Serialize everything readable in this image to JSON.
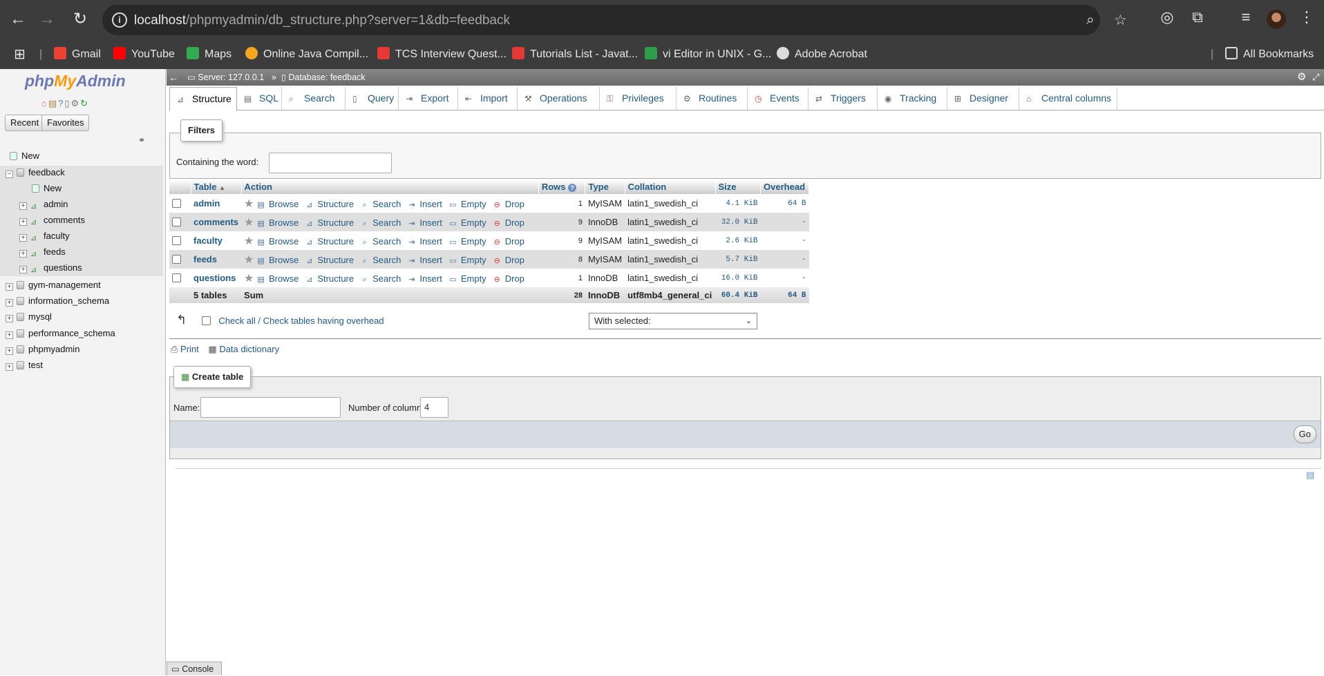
{
  "browser": {
    "url_host": "localhost",
    "url_path": "/phpmyadmin/db_structure.php?server=1&db=feedback",
    "bookmarks": [
      {
        "label": "Gmail",
        "color": "#ea4335"
      },
      {
        "label": "YouTube",
        "color": "#ff0000"
      },
      {
        "label": "Maps",
        "color": "#34a853"
      },
      {
        "label": "Online Java Compil...",
        "color": "#f5a623"
      },
      {
        "label": "TCS Interview Quest...",
        "color": "#e53935"
      },
      {
        "label": "Tutorials List - Javat...",
        "color": "#e53935"
      },
      {
        "label": "vi Editor in UNIX - G...",
        "color": "#2e9c4a"
      },
      {
        "label": "Adobe Acrobat",
        "color": "#dddddd"
      }
    ],
    "all_bookmarks": "All Bookmarks"
  },
  "sidebar": {
    "logo_php": "php",
    "logo_my": "My",
    "logo_admin": "Admin",
    "recent": "Recent",
    "favorites": "Favorites",
    "tree": {
      "new_root": "New",
      "feedback": "feedback",
      "new_table": "New",
      "tables": [
        "admin",
        "comments",
        "faculty",
        "feeds",
        "questions"
      ],
      "databases": [
        "gym-management",
        "information_schema",
        "mysql",
        "performance_schema",
        "phpmyadmin",
        "test"
      ]
    }
  },
  "breadcrumb": {
    "server": "Server: 127.0.0.1",
    "sep": "»",
    "database": "Database: feedback"
  },
  "tabs": [
    "Structure",
    "SQL",
    "Search",
    "Query",
    "Export",
    "Import",
    "Operations",
    "Privileges",
    "Routines",
    "Events",
    "Triggers",
    "Tracking",
    "Designer",
    "Central columns"
  ],
  "filters": {
    "legend": "Filters",
    "label": "Containing the word:",
    "value": ""
  },
  "table": {
    "headers": {
      "table": "Table",
      "action": "Action",
      "rows": "Rows",
      "type": "Type",
      "collation": "Collation",
      "size": "Size",
      "overhead": "Overhead"
    },
    "actions": [
      "Browse",
      "Structure",
      "Search",
      "Insert",
      "Empty",
      "Drop"
    ],
    "rows": [
      {
        "name": "admin",
        "rows": "1",
        "type": "MyISAM",
        "collation": "latin1_swedish_ci",
        "size": "4.1 KiB",
        "overhead": "64 B"
      },
      {
        "name": "comments",
        "rows": "9",
        "type": "InnoDB",
        "collation": "latin1_swedish_ci",
        "size": "32.0 KiB",
        "overhead": "-"
      },
      {
        "name": "faculty",
        "rows": "9",
        "type": "MyISAM",
        "collation": "latin1_swedish_ci",
        "size": "2.6 KiB",
        "overhead": "-"
      },
      {
        "name": "feeds",
        "rows": "8",
        "type": "MyISAM",
        "collation": "latin1_swedish_ci",
        "size": "5.7 KiB",
        "overhead": "-"
      },
      {
        "name": "questions",
        "rows": "1",
        "type": "InnoDB",
        "collation": "latin1_swedish_ci",
        "size": "16.0 KiB",
        "overhead": "-"
      }
    ],
    "footer": {
      "name": "5 tables",
      "sum": "Sum",
      "rows": "28",
      "type": "InnoDB",
      "collation": "utf8mb4_general_ci",
      "size": "60.4 KiB",
      "overhead": "64 B"
    }
  },
  "bulk": {
    "check_all": "Check all / Check tables having overhead",
    "with_selected": "With selected:"
  },
  "links": {
    "print": "Print",
    "data_dictionary": "Data dictionary"
  },
  "create_table": {
    "legend": "Create table",
    "name_label": "Name:",
    "name_value": "",
    "columns_label": "Number of columns:",
    "columns_value": "4",
    "go": "Go"
  },
  "console": "Console"
}
